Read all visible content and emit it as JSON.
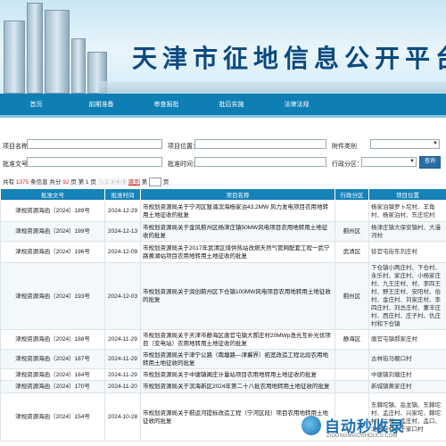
{
  "banner": {
    "title": "天津市征地信息公开平台"
  },
  "nav": [
    "首页",
    "前期准备",
    "审查报批",
    "批后实施",
    "法律法规"
  ],
  "filters": {
    "item_name": "项目名称：",
    "item_location": "项目位置：",
    "attachment_type": "附件类别",
    "approval_doc": "批准文号：",
    "approval_time": "批准时间：",
    "district": "行政分区：",
    "search": "查询"
  },
  "pager": {
    "total_prefix": "共有",
    "total": "1375",
    "total_suffix": "条信息 共分",
    "pages": "92",
    "pages_suffix": "页 第",
    "current": "1",
    "current_suffix": "页",
    "nav_glyphs": "①②③④⑤",
    "goto": "跳到",
    "goto_suffix": "第",
    "goto_value": "1",
    "page_word": "页"
  },
  "table": {
    "headers": [
      "批准文号",
      "批准时间",
      "项目名称",
      "行政分区",
      "项目位置"
    ],
    "rows": [
      {
        "doc": "津规资源海函〔2024〕189号",
        "date": "2024-12-29",
        "name": "市规划资源局关于宁河区暂涌滨海杨家泊43.2MW 风力发电项目农用地转用土地征收的批复",
        "district": "",
        "location": "杨家泊镇罗卜坨村、羊角村、杨家泊村、东庄坨村"
      },
      {
        "doc": "津规资源海函〔2024〕199号",
        "date": "2024-12-13",
        "name": "市规划资源局关于金风蓟州区杨津庄镇50MW风电项目农用地转用土地征收的批复",
        "district": "蓟州区",
        "location": "杨津庄镇大保安镇村、大漫河村"
      },
      {
        "doc": "津规资源海函〔2024〕196号",
        "date": "2024-12-09",
        "name": "市规划资源局关于2017年武清区煤供热站改燃天然气管网配套工程一武宁路黄湖站项目农用地转用土地征收的批复",
        "district": "武清区",
        "location": "徐官屯街东刘庄村"
      },
      {
        "doc": "津规资源海函〔2024〕193号",
        "date": "2024-12-03",
        "name": "市规划资源局关于润创蓟州区下仓镇100MW风电项目农用地转用土地征收的批复",
        "district": "蓟州区",
        "location": "下仓镇小两庄村、下仓村、永乐村、家庄村、小杨家庄村、九王庄村、村、李四王村、野王庄村、安阳村、伯村、金庄村、刘家庄村、李四庄村、刘总庄村、董辛庄村、西庄村、庄子村、仇庄村和下仓镇"
      },
      {
        "doc": "津规资源海函〔2024〕188号",
        "date": "2024-11-29",
        "name": "市规划资源局关于天津市静海区唐官屯镇大郝庄村20MWp渔光互补光伏项目（变电站）农用地转用土地征收的批复",
        "district": "静海区",
        "location": "唐官屯镇郝家庄村"
      },
      {
        "doc": "津规资源海函〔2024〕187号",
        "date": "2024-11-29",
        "name": "市规划资源局关于津宁公路（南塘路—津冀界）拓宽改造工程北段农用地转用土地征收的批复",
        "district": "",
        "location": "古林街马棚口村"
      },
      {
        "doc": "津规资源海函〔2024〕184号",
        "date": "2024-11-29",
        "name": "市规划资源局关于中塘镇阁庄计量站项目农用地转用土地征收的批复",
        "district": "",
        "location": "中塘镇刘塘庄村"
      },
      {
        "doc": "津规资源海函〔2024〕170号",
        "date": "2024-11-20",
        "name": "市规划资源局关于滨海新区2024年第二十八批农用地转用土地征收的批复",
        "district": "",
        "location": "新城镇黄家庄村"
      },
      {
        "doc": "津规资源海函〔2024〕154号",
        "date": "2024-10-28",
        "name": "市规划资源局关于蓟运河提标改造工程（宁河区段）项目农用地转用土地征收的批复",
        "district": "",
        "location": "东棘坨镇、岳龙镇、东棘坨村、孟庄村、兴家坨、棘坨村、六村、孟庄村、孟口、北淮淀村、于家口村"
      }
    ]
  },
  "watermark": {
    "brand": "自动秒收录",
    "sub": "ZIDONGMIAOSHOULU.COM"
  }
}
